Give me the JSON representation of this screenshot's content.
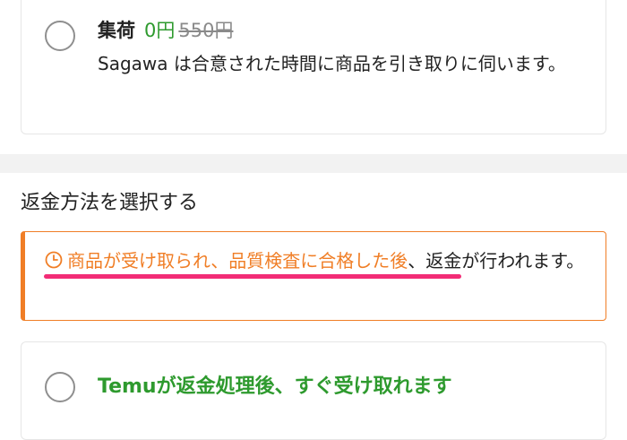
{
  "pickup": {
    "title": "集荷",
    "price": "0円",
    "original_price": "550円",
    "description": "Sagawa は合意された時間に商品を引き取りに伺います。"
  },
  "refund_section": {
    "title": "返金方法を選択する"
  },
  "notice": {
    "icon": "clock-icon",
    "highlight": "商品が受け取られ、品質検査に合格した後",
    "rest": "、返金が行われます。"
  },
  "refund_option": {
    "label": "Temuが返金処理後、すぐ受け取れます"
  },
  "colors": {
    "accent_orange": "#f07e26",
    "green": "#2e9a2e",
    "underline_pink": "#f22c76",
    "radio_border": "#8f8f8f"
  }
}
